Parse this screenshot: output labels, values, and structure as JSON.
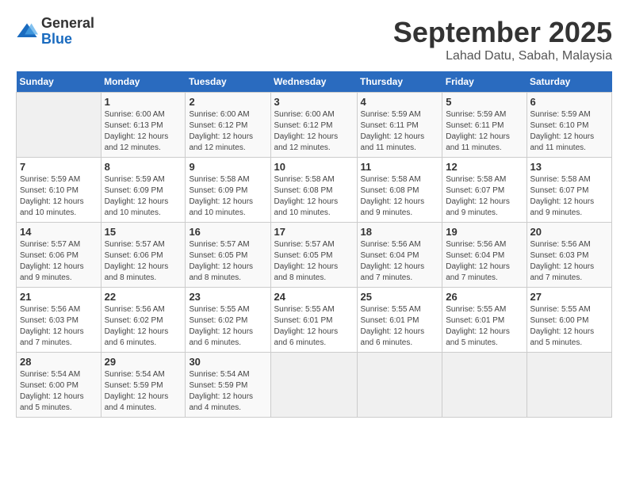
{
  "logo": {
    "general": "General",
    "blue": "Blue"
  },
  "title": "September 2025",
  "subtitle": "Lahad Datu, Sabah, Malaysia",
  "weekdays": [
    "Sunday",
    "Monday",
    "Tuesday",
    "Wednesday",
    "Thursday",
    "Friday",
    "Saturday"
  ],
  "weeks": [
    [
      {
        "day": "",
        "info": ""
      },
      {
        "day": "1",
        "info": "Sunrise: 6:00 AM\nSunset: 6:13 PM\nDaylight: 12 hours\nand 12 minutes."
      },
      {
        "day": "2",
        "info": "Sunrise: 6:00 AM\nSunset: 6:12 PM\nDaylight: 12 hours\nand 12 minutes."
      },
      {
        "day": "3",
        "info": "Sunrise: 6:00 AM\nSunset: 6:12 PM\nDaylight: 12 hours\nand 12 minutes."
      },
      {
        "day": "4",
        "info": "Sunrise: 5:59 AM\nSunset: 6:11 PM\nDaylight: 12 hours\nand 11 minutes."
      },
      {
        "day": "5",
        "info": "Sunrise: 5:59 AM\nSunset: 6:11 PM\nDaylight: 12 hours\nand 11 minutes."
      },
      {
        "day": "6",
        "info": "Sunrise: 5:59 AM\nSunset: 6:10 PM\nDaylight: 12 hours\nand 11 minutes."
      }
    ],
    [
      {
        "day": "7",
        "info": "Sunrise: 5:59 AM\nSunset: 6:10 PM\nDaylight: 12 hours\nand 10 minutes."
      },
      {
        "day": "8",
        "info": "Sunrise: 5:59 AM\nSunset: 6:09 PM\nDaylight: 12 hours\nand 10 minutes."
      },
      {
        "day": "9",
        "info": "Sunrise: 5:58 AM\nSunset: 6:09 PM\nDaylight: 12 hours\nand 10 minutes."
      },
      {
        "day": "10",
        "info": "Sunrise: 5:58 AM\nSunset: 6:08 PM\nDaylight: 12 hours\nand 10 minutes."
      },
      {
        "day": "11",
        "info": "Sunrise: 5:58 AM\nSunset: 6:08 PM\nDaylight: 12 hours\nand 9 minutes."
      },
      {
        "day": "12",
        "info": "Sunrise: 5:58 AM\nSunset: 6:07 PM\nDaylight: 12 hours\nand 9 minutes."
      },
      {
        "day": "13",
        "info": "Sunrise: 5:58 AM\nSunset: 6:07 PM\nDaylight: 12 hours\nand 9 minutes."
      }
    ],
    [
      {
        "day": "14",
        "info": "Sunrise: 5:57 AM\nSunset: 6:06 PM\nDaylight: 12 hours\nand 9 minutes."
      },
      {
        "day": "15",
        "info": "Sunrise: 5:57 AM\nSunset: 6:06 PM\nDaylight: 12 hours\nand 8 minutes."
      },
      {
        "day": "16",
        "info": "Sunrise: 5:57 AM\nSunset: 6:05 PM\nDaylight: 12 hours\nand 8 minutes."
      },
      {
        "day": "17",
        "info": "Sunrise: 5:57 AM\nSunset: 6:05 PM\nDaylight: 12 hours\nand 8 minutes."
      },
      {
        "day": "18",
        "info": "Sunrise: 5:56 AM\nSunset: 6:04 PM\nDaylight: 12 hours\nand 7 minutes."
      },
      {
        "day": "19",
        "info": "Sunrise: 5:56 AM\nSunset: 6:04 PM\nDaylight: 12 hours\nand 7 minutes."
      },
      {
        "day": "20",
        "info": "Sunrise: 5:56 AM\nSunset: 6:03 PM\nDaylight: 12 hours\nand 7 minutes."
      }
    ],
    [
      {
        "day": "21",
        "info": "Sunrise: 5:56 AM\nSunset: 6:03 PM\nDaylight: 12 hours\nand 7 minutes."
      },
      {
        "day": "22",
        "info": "Sunrise: 5:56 AM\nSunset: 6:02 PM\nDaylight: 12 hours\nand 6 minutes."
      },
      {
        "day": "23",
        "info": "Sunrise: 5:55 AM\nSunset: 6:02 PM\nDaylight: 12 hours\nand 6 minutes."
      },
      {
        "day": "24",
        "info": "Sunrise: 5:55 AM\nSunset: 6:01 PM\nDaylight: 12 hours\nand 6 minutes."
      },
      {
        "day": "25",
        "info": "Sunrise: 5:55 AM\nSunset: 6:01 PM\nDaylight: 12 hours\nand 6 minutes."
      },
      {
        "day": "26",
        "info": "Sunrise: 5:55 AM\nSunset: 6:01 PM\nDaylight: 12 hours\nand 5 minutes."
      },
      {
        "day": "27",
        "info": "Sunrise: 5:55 AM\nSunset: 6:00 PM\nDaylight: 12 hours\nand 5 minutes."
      }
    ],
    [
      {
        "day": "28",
        "info": "Sunrise: 5:54 AM\nSunset: 6:00 PM\nDaylight: 12 hours\nand 5 minutes."
      },
      {
        "day": "29",
        "info": "Sunrise: 5:54 AM\nSunset: 5:59 PM\nDaylight: 12 hours\nand 4 minutes."
      },
      {
        "day": "30",
        "info": "Sunrise: 5:54 AM\nSunset: 5:59 PM\nDaylight: 12 hours\nand 4 minutes."
      },
      {
        "day": "",
        "info": ""
      },
      {
        "day": "",
        "info": ""
      },
      {
        "day": "",
        "info": ""
      },
      {
        "day": "",
        "info": ""
      }
    ]
  ]
}
